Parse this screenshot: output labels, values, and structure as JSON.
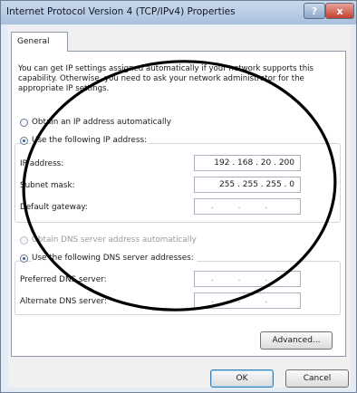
{
  "window": {
    "title": "Internet Protocol Version 4 (TCP/IPv4) Properties",
    "help_label": "?",
    "close_label": "x"
  },
  "tab": {
    "general_label": "General"
  },
  "description": "You can get IP settings assigned automatically if your network supports this capability. Otherwise, you need to ask your network administrator for the appropriate IP settings.",
  "ip_settings": {
    "auto_label": "Obtain an IP address automatically",
    "auto_selected": false,
    "manual_label": "Use the following IP address:",
    "manual_selected": true,
    "ip_address_label": "IP address:",
    "ip_address_value": "192 . 168 . 20 . 200",
    "subnet_mask_label": "Subnet mask:",
    "subnet_mask_value": "255 . 255 . 255 . 0",
    "default_gateway_label": "Default gateway:",
    "default_gateway_value": ". . ."
  },
  "dns_settings": {
    "auto_label": "Obtain DNS server address automatically",
    "auto_selected": false,
    "manual_label": "Use the following DNS server addresses:",
    "manual_selected": true,
    "preferred_label": "Preferred DNS server:",
    "preferred_value": ". . .",
    "alternate_label": "Alternate DNS server:",
    "alternate_value": ". . ."
  },
  "buttons": {
    "advanced_label": "Advanced...",
    "ok_label": "OK",
    "cancel_label": "Cancel"
  },
  "colors": {
    "annotation_ellipse": "#000000",
    "radio_checked": "#2a5fb0"
  }
}
